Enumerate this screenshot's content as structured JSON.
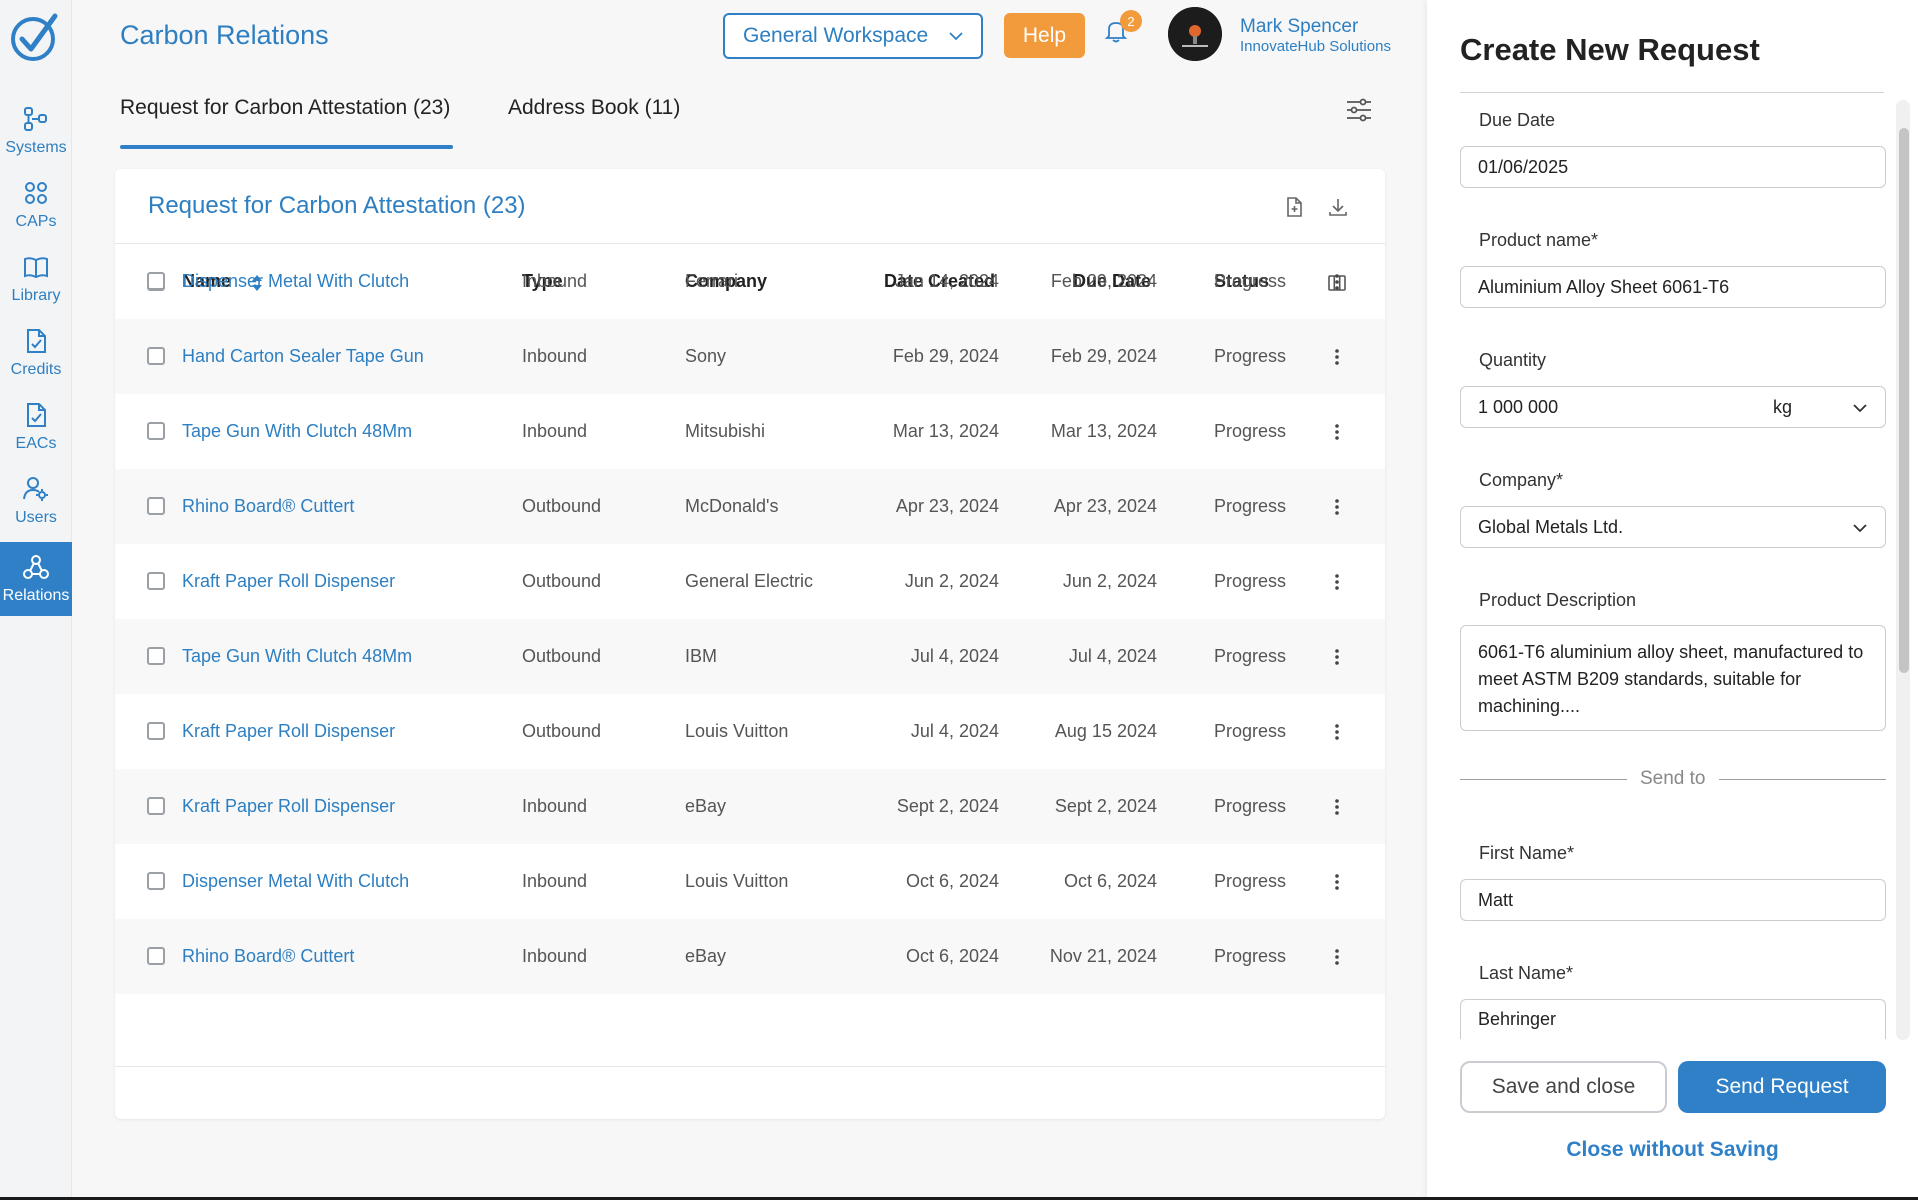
{
  "app": {
    "title": "Carbon Relations"
  },
  "sidebar": {
    "items": [
      {
        "label": "Systems",
        "icon": "systems-icon"
      },
      {
        "label": "CAPs",
        "icon": "caps-icon"
      },
      {
        "label": "Library",
        "icon": "library-icon"
      },
      {
        "label": "Credits",
        "icon": "credits-icon"
      },
      {
        "label": "EACs",
        "icon": "eacs-icon"
      },
      {
        "label": "Users",
        "icon": "users-icon"
      },
      {
        "label": "Relations",
        "icon": "relations-icon",
        "active": true
      }
    ]
  },
  "header": {
    "workspace": "General Workspace",
    "help_label": "Help",
    "notification_count": "2",
    "user_name": "Mark Spencer",
    "user_org": "InnovateHub Solutions"
  },
  "tabs": [
    {
      "label": "Request for Carbon Attestation (23)",
      "active": true
    },
    {
      "label": "Address Book (11)",
      "active": false
    }
  ],
  "table": {
    "title": "Request for Carbon Attestation (23)",
    "columns": [
      "Name",
      "Type",
      "Company",
      "Date Created",
      "Due Date",
      "Status"
    ],
    "rows": [
      {
        "name": "Dispenser Metal With Clutch",
        "type": "Inbound",
        "company": "Ferrari",
        "created": "Jan 14, 2024",
        "due": "Feb 29, 2024",
        "status": "Progress"
      },
      {
        "name": "Hand Carton Sealer Tape Gun",
        "type": "Inbound",
        "company": "Sony",
        "created": "Feb 29, 2024",
        "due": "Feb 29, 2024",
        "status": "Progress"
      },
      {
        "name": "Tape Gun With Clutch 48Mm",
        "type": "Inbound",
        "company": "Mitsubishi",
        "created": "Mar 13, 2024",
        "due": "Mar 13, 2024",
        "status": "Progress"
      },
      {
        "name": "Rhino Board® Cuttert",
        "type": "Outbound",
        "company": "McDonald's",
        "created": "Apr 23, 2024",
        "due": "Apr 23, 2024",
        "status": "Progress"
      },
      {
        "name": "Kraft Paper Roll Dispenser",
        "type": "Outbound",
        "company": "General Electric",
        "created": "Jun 2, 2024",
        "due": "Jun 2, 2024",
        "status": "Progress"
      },
      {
        "name": "Tape Gun With Clutch 48Mm",
        "type": "Outbound",
        "company": "IBM",
        "created": "Jul 4, 2024",
        "due": "Jul 4, 2024",
        "status": "Progress"
      },
      {
        "name": "Kraft Paper Roll Dispenser",
        "type": "Outbound",
        "company": "Louis Vuitton",
        "created": "Jul 4, 2024",
        "due": "Aug 15 2024",
        "status": "Progress"
      },
      {
        "name": "Kraft Paper Roll Dispenser",
        "type": "Inbound",
        "company": "eBay",
        "created": "Sept 2, 2024",
        "due": "Sept 2, 2024",
        "status": "Progress"
      },
      {
        "name": "Dispenser Metal With Clutch",
        "type": "Inbound",
        "company": "Louis Vuitton",
        "created": "Oct 6, 2024",
        "due": "Oct 6, 2024",
        "status": "Progress"
      },
      {
        "name": "Rhino Board® Cuttert",
        "type": "Inbound",
        "company": "eBay",
        "created": "Oct 6, 2024",
        "due": "Nov 21, 2024",
        "status": "Progress"
      }
    ]
  },
  "panel": {
    "title": "Create New Request",
    "due_date_label": "Due Date",
    "due_date": "01/06/2025",
    "product_label": "Product name*",
    "product": "Aluminium Alloy Sheet 6061-T6",
    "quantity_label": "Quantity",
    "quantity": "1 000 000",
    "unit": "kg",
    "company_label": "Company*",
    "company": "Global Metals Ltd.",
    "description_label": "Product Description",
    "description": "6061-T6 aluminium alloy sheet, manufactured to meet ASTM B209 standards, suitable for machining....",
    "send_to": "Send to",
    "first_name_label": "First Name*",
    "first_name": "Matt",
    "last_name_label": "Last Name*",
    "last_name": "Behringer",
    "save_close": "Save and close",
    "send_request": "Send Request",
    "close_without_saving": "Close without Saving"
  },
  "colors": {
    "accent": "#2f80c7",
    "help": "#f29b3c"
  }
}
